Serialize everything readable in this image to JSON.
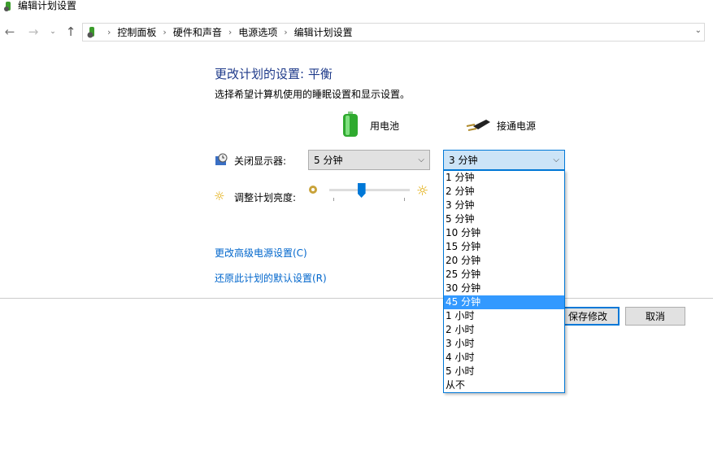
{
  "window": {
    "title": "编辑计划设置"
  },
  "breadcrumb": [
    "控制面板",
    "硬件和声音",
    "电源选项",
    "编辑计划设置"
  ],
  "heading": "更改计划的设置: 平衡",
  "subtitle": "选择希望计算机使用的睡眠设置和显示设置。",
  "columns": {
    "battery": "用电池",
    "plugged": "接通电源"
  },
  "display_off": {
    "label": "关闭显示器:",
    "battery_value": "5 分钟",
    "plugged_value": "3 分钟"
  },
  "brightness": {
    "label": "调整计划亮度:",
    "level_percent": 40
  },
  "dropdown": {
    "options": [
      "1 分钟",
      "2 分钟",
      "3 分钟",
      "5 分钟",
      "10 分钟",
      "15 分钟",
      "20 分钟",
      "25 分钟",
      "30 分钟",
      "45 分钟",
      "1 小时",
      "2 小时",
      "3 小时",
      "4 小时",
      "5 小时",
      "从不"
    ],
    "highlighted": "45 分钟"
  },
  "links": {
    "advanced": "更改高级电源设置(C)",
    "restore": "还原此计划的默认设置(R)"
  },
  "buttons": {
    "save": "保存修改",
    "cancel": "取消"
  },
  "colors": {
    "accent": "#0078d7",
    "highlight": "#3399ff",
    "link": "#0066cc"
  }
}
